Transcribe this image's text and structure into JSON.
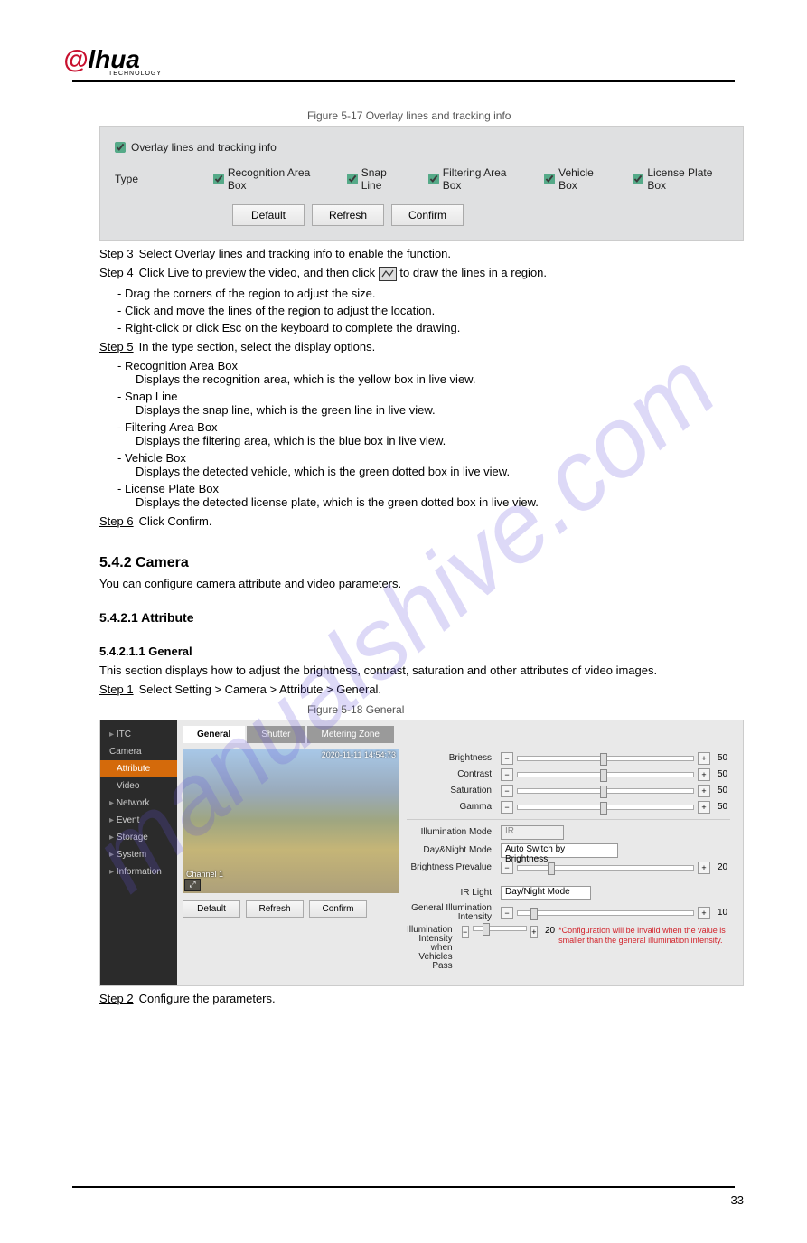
{
  "watermark": "manualshive.com",
  "brand": {
    "tagline": "TECHNOLOGY"
  },
  "page_number": "33",
  "panel1": {
    "caption": "Figure 5-17 Overlay lines and tracking info",
    "overlay_label": "Overlay lines and tracking info",
    "type_label": "Type",
    "types": [
      "Recognition Area Box",
      "Snap Line",
      "Filtering Area Box",
      "Vehicle Box",
      "License Plate Box"
    ]
  },
  "buttons": {
    "default": "Default",
    "refresh": "Refresh",
    "confirm": "Confirm"
  },
  "steps": {
    "s3": {
      "num": "Step 3",
      "text": "Select Overlay lines and tracking info to enable the function."
    },
    "s4": {
      "num": "Step 4",
      "text_a": "Click Live to preview the video, and then click",
      "text_b": " to draw the lines in a region.",
      "bullets": [
        "Drag the corners of the region to adjust the size.",
        "Click and move the lines of the region to adjust the location.",
        "Right-click or click Esc on the keyboard to complete the drawing."
      ]
    },
    "s5": {
      "num": "Step 5",
      "text": "In the type section, select the display options.",
      "opts": [
        {
          "t": "Recognition Area Box",
          "d": "Displays the recognition area, which is the yellow box in live view."
        },
        {
          "t": "Snap Line",
          "d": "Displays the snap line, which is the green line in live view."
        },
        {
          "t": "Filtering Area Box",
          "d": "Displays the filtering area, which is the blue box in live view."
        },
        {
          "t": "Vehicle Box",
          "d": "Displays the detected vehicle, which is the green dotted box in live view."
        },
        {
          "t": "License Plate Box",
          "d": "Displays the detected license plate, which is the green dotted box in live view."
        }
      ]
    },
    "s6": {
      "num": "Step 6",
      "text": "Click Confirm."
    },
    "a1": {
      "num": "Step 1",
      "text": "Select Setting > Camera > Attribute > General."
    },
    "a2": {
      "num": "Step 2",
      "text": "Configure the parameters."
    }
  },
  "headings": {
    "camera": "5.4.2 Camera",
    "attribute": "5.4.2.1 Attribute",
    "general": "5.4.2.1.1 General"
  },
  "text": {
    "camera_desc": "You can configure camera attribute and video parameters.",
    "general_desc": "This section displays how to adjust the brightness, contrast, saturation and other attributes of video images."
  },
  "panel2": {
    "caption": "Figure 5-18 General"
  },
  "sidebar": [
    "ITC",
    "Camera",
    "Attribute",
    "Video",
    "Network",
    "Event",
    "Storage",
    "System",
    "Information"
  ],
  "tabs": [
    "General",
    "Shutter",
    "Metering Zone"
  ],
  "preview": {
    "timestamp": "2020-11-11 14:54:73",
    "channel": "Channel 1"
  },
  "ctrl": {
    "brightness": {
      "l": "Brightness",
      "v": "50"
    },
    "contrast": {
      "l": "Contrast",
      "v": "50"
    },
    "saturation": {
      "l": "Saturation",
      "v": "50"
    },
    "gamma": {
      "l": "Gamma",
      "v": "50"
    },
    "illum_mode": {
      "l": "Illumination Mode",
      "v": "IR"
    },
    "dn_mode": {
      "l": "Day&Night Mode",
      "v": "Auto Switch by Brightness"
    },
    "bpre": {
      "l": "Brightness Prevalue",
      "v": "20"
    },
    "ir": {
      "l": "IR Light",
      "v": "Day/Night Mode"
    },
    "gint": {
      "l": "General Illumination Intensity",
      "v": "10"
    },
    "pint": {
      "l": "Illumination Intensity when Vehicles Pass",
      "v": "20",
      "warn": "*Configuration will be invalid when the value is smaller than the general illumination intensity."
    }
  }
}
